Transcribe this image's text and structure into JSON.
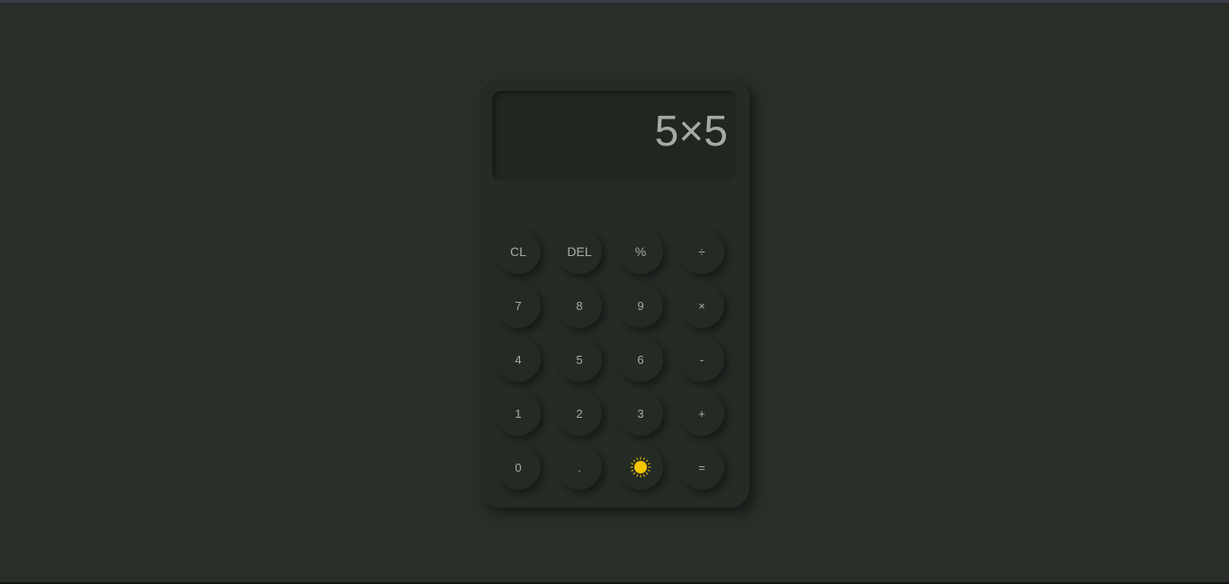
{
  "display": {
    "expression": "5×5"
  },
  "keypad": {
    "rows": [
      [
        "CL",
        "DEL",
        "%",
        "÷"
      ],
      [
        "7",
        "8",
        "9",
        "×"
      ],
      [
        "4",
        "5",
        "6",
        "-"
      ],
      [
        "1",
        "2",
        "3",
        "+"
      ],
      [
        "0",
        ".",
        "",
        "="
      ]
    ],
    "theme_toggle_icon": "sun-icon"
  },
  "colors": {
    "background": "#292e29",
    "calculator_body": "#262b26",
    "display_bg": "#202720",
    "key_bg": "#242b24",
    "text": "#a7ada7",
    "sun": "#f5c400"
  }
}
